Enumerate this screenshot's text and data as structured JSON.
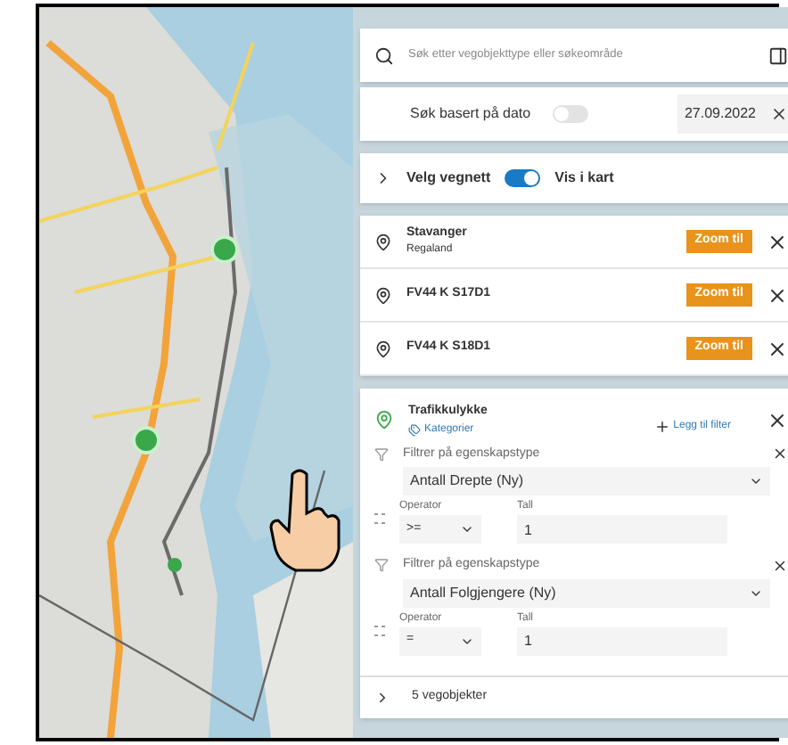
{
  "search": {
    "placeholder": "Søk etter vegobjekttype eller søkeområde"
  },
  "date_filter": {
    "label": "Søk basert på dato",
    "on": false,
    "value": "27.09.2022"
  },
  "road_network": {
    "label": "Velg vegnett",
    "expanded": false,
    "show_on_map": {
      "label": "Vis i kart",
      "on": true
    }
  },
  "areas": [
    {
      "name": "Stavanger",
      "subtitle": "Regaland",
      "button": "Zoom til"
    },
    {
      "name": "FV44 K S17D1",
      "button": "Zoom til"
    },
    {
      "name": "FV44 K S18D1",
      "button": "Zoom til"
    }
  ],
  "object_type": {
    "name": "Trafikkulykke",
    "link": "Kategorier",
    "add_filter": "Legg til filter",
    "filters": [
      {
        "label": "Filtrer på egenskapstype",
        "property": "Antall Drepte (Ny)",
        "operator_label": "Operator",
        "operator": ">=",
        "value_label": "Tall",
        "value": "1"
      },
      {
        "label": "Filtrer på egenskapstype",
        "property": "Antall Folgjengere (Ny)",
        "operator_label": "Operator",
        "operator": "=",
        "value_label": "Tall",
        "value": "1"
      }
    ],
    "results": {
      "label": "5 vegobjekter",
      "expanded": false
    }
  }
}
